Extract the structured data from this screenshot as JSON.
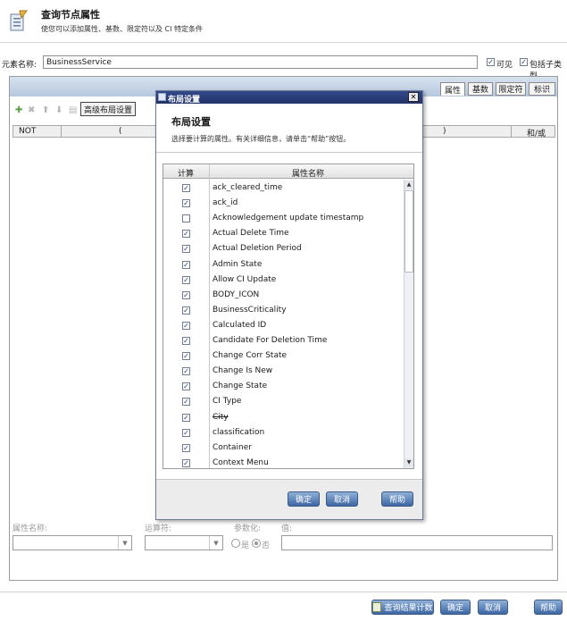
{
  "header": {
    "title": "查询节点属性",
    "subtitle": "使您可以添加属性、基数、限定符以及 CI 特定条件"
  },
  "element_name": {
    "label": "元素名称:",
    "value": "BusinessService",
    "visible_label": "可见",
    "visible_checked": true,
    "include_subtypes_label": "包括子类型",
    "include_subtypes_checked": true
  },
  "tabs": [
    "属性",
    "基数",
    "限定符",
    "标识"
  ],
  "toolbar": {
    "advanced_layout_label": "高级布局设置"
  },
  "table_headers": {
    "not": "NOT",
    "open_paren": "(",
    "close_paren": ")",
    "and_or": "和/或"
  },
  "dialog": {
    "titlebar": "布局设置",
    "heading": "布局设置",
    "description": "选择要计算的属性。有关详细信息，请单击“帮助”按钮。",
    "col_calc": "计算",
    "col_attr": "属性名称",
    "rows": [
      {
        "name": "ack_cleared_time",
        "checked": true,
        "strike": false
      },
      {
        "name": "ack_id",
        "checked": true,
        "strike": false
      },
      {
        "name": "Acknowledgement update timestamp",
        "checked": false,
        "strike": false
      },
      {
        "name": "Actual Delete Time",
        "checked": true,
        "strike": false
      },
      {
        "name": "Actual Deletion Period",
        "checked": true,
        "strike": false
      },
      {
        "name": "Admin State",
        "checked": true,
        "strike": false
      },
      {
        "name": "Allow CI Update",
        "checked": true,
        "strike": false
      },
      {
        "name": "BODY_ICON",
        "checked": true,
        "strike": false
      },
      {
        "name": "BusinessCriticality",
        "checked": true,
        "strike": false
      },
      {
        "name": "Calculated ID",
        "checked": true,
        "strike": false
      },
      {
        "name": "Candidate For Deletion Time",
        "checked": true,
        "strike": false
      },
      {
        "name": "Change Corr State",
        "checked": true,
        "strike": false
      },
      {
        "name": "Change Is New",
        "checked": true,
        "strike": false
      },
      {
        "name": "Change State",
        "checked": true,
        "strike": false
      },
      {
        "name": "CI Type",
        "checked": true,
        "strike": false
      },
      {
        "name": "City",
        "checked": true,
        "strike": true
      },
      {
        "name": "classification",
        "checked": true,
        "strike": false
      },
      {
        "name": "Container",
        "checked": true,
        "strike": false
      },
      {
        "name": "Context Menu",
        "checked": true,
        "strike": false
      }
    ],
    "ok_label": "确定",
    "cancel_label": "取消",
    "help_label": "帮助",
    "close_glyph": "✕"
  },
  "condition": {
    "attr_label": "属性名称:",
    "operator_label": "运算符:",
    "param_label": "参数化:",
    "yes_label": "是",
    "no_label": "否",
    "no_selected": true,
    "value_label": "值:"
  },
  "footer": {
    "calc_results_label": "查询结果计数",
    "ok_label": "确定",
    "cancel_label": "取消",
    "help_label": "帮助"
  },
  "icons": {
    "header": "query-node-icon",
    "dialog": "dialog-icon",
    "toolbar": [
      "add-icon",
      "delete-icon",
      "move-up-icon",
      "move-down-icon",
      "copy-icon"
    ]
  },
  "colors": {
    "button_blue": "#3d67a3",
    "dialog_title": "#2b3a6c",
    "checkbox_check": "#1e3f7a"
  }
}
